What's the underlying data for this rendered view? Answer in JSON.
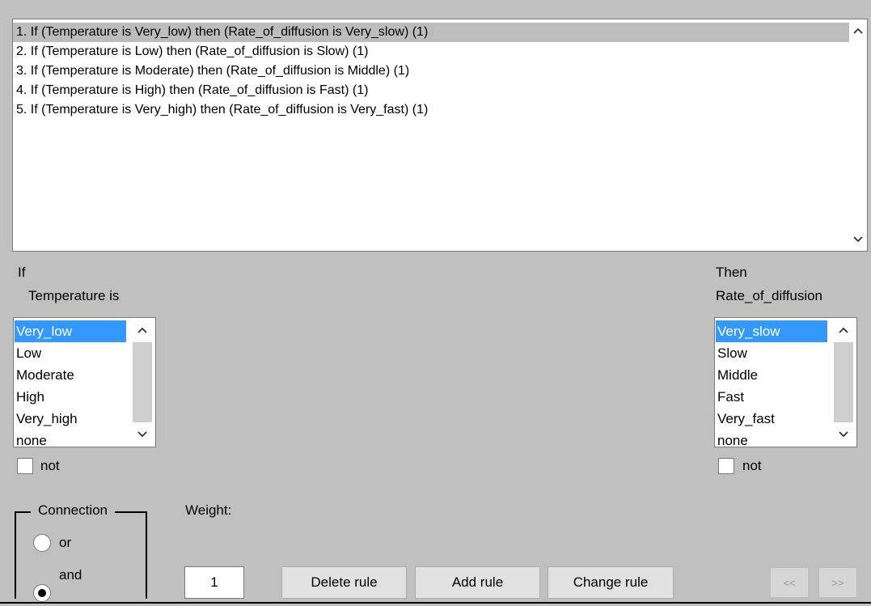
{
  "rules": [
    "1. If (Temperature is Very_low) then (Rate_of_diffusion is Very_slow) (1)",
    "2. If (Temperature is Low) then (Rate_of_diffusion is Slow) (1)",
    "3. If (Temperature is Moderate) then (Rate_of_diffusion is Middle) (1)",
    "4. If (Temperature is High) then (Rate_of_diffusion is Fast) (1)",
    "5. If (Temperature is Very_high) then (Rate_of_diffusion is Very_fast) (1)"
  ],
  "selected_rule": 0,
  "if_panel": {
    "label": "If",
    "variable_label": "Temperature is",
    "options": [
      "Very_low",
      "Low",
      "Moderate",
      "High",
      "Very_high",
      "none"
    ],
    "selected": "Very_low",
    "not_label": "not",
    "not_checked": false
  },
  "then_panel": {
    "label": "Then",
    "variable_label": "Rate_of_diffusion",
    "options": [
      "Very_slow",
      "Slow",
      "Middle",
      "Fast",
      "Very_fast",
      "none"
    ],
    "selected": "Very_slow",
    "not_label": "not",
    "not_checked": false
  },
  "connection": {
    "legend": "Connection",
    "or_label": "or",
    "and_label": "and",
    "selected": "and"
  },
  "weight": {
    "label": "Weight:",
    "value": "1"
  },
  "buttons": {
    "delete": "Delete rule",
    "add": "Add rule",
    "change": "Change rule",
    "prev": "<<",
    "next": ">>"
  },
  "icons": {
    "scroll_up": "chevron-up-icon",
    "scroll_down": "chevron-down-icon"
  }
}
